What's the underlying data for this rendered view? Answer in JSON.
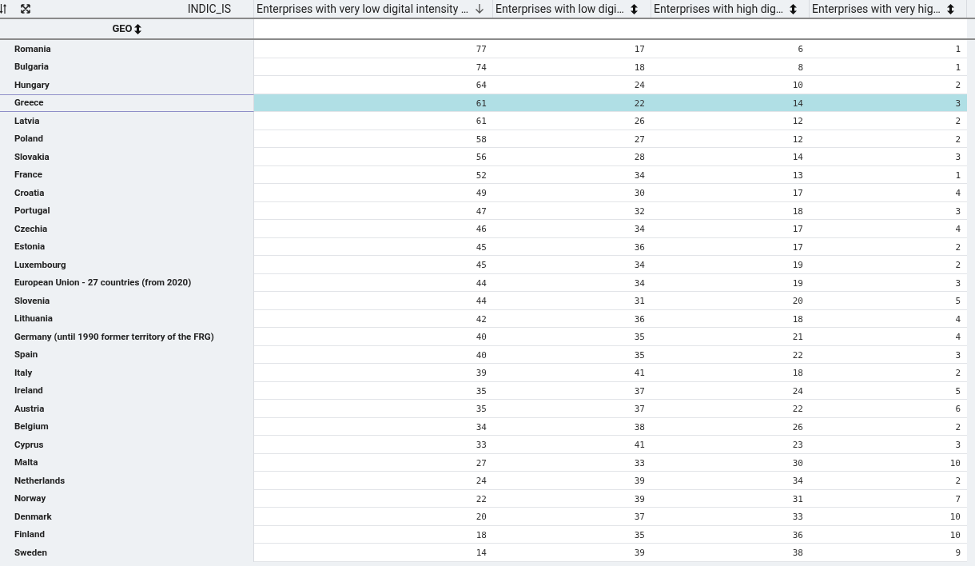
{
  "toolbar": {
    "pivot_label": "INDIC_IS",
    "row_header": "GEO"
  },
  "columns": [
    {
      "label": "Enterprises with very low digital intensity …",
      "sorted": true
    },
    {
      "label": "Enterprises with low digi…",
      "sorted": false
    },
    {
      "label": "Enterprises with high dig…",
      "sorted": false
    },
    {
      "label": "Enterprises with very hig…",
      "sorted": false
    }
  ],
  "rows": [
    {
      "geo": "Romania",
      "values": [
        "77",
        "17",
        "6",
        "1"
      ],
      "selected": false
    },
    {
      "geo": "Bulgaria",
      "values": [
        "74",
        "18",
        "8",
        "1"
      ],
      "selected": false
    },
    {
      "geo": "Hungary",
      "values": [
        "64",
        "24",
        "10",
        "2"
      ],
      "selected": false
    },
    {
      "geo": "Greece",
      "values": [
        "61",
        "22",
        "14",
        "3"
      ],
      "selected": true
    },
    {
      "geo": "Latvia",
      "values": [
        "61",
        "26",
        "12",
        "2"
      ],
      "selected": false
    },
    {
      "geo": "Poland",
      "values": [
        "58",
        "27",
        "12",
        "2"
      ],
      "selected": false
    },
    {
      "geo": "Slovakia",
      "values": [
        "56",
        "28",
        "14",
        "3"
      ],
      "selected": false
    },
    {
      "geo": "France",
      "values": [
        "52",
        "34",
        "13",
        "1"
      ],
      "selected": false
    },
    {
      "geo": "Croatia",
      "values": [
        "49",
        "30",
        "17",
        "4"
      ],
      "selected": false
    },
    {
      "geo": "Portugal",
      "values": [
        "47",
        "32",
        "18",
        "3"
      ],
      "selected": false
    },
    {
      "geo": "Czechia",
      "values": [
        "46",
        "34",
        "17",
        "4"
      ],
      "selected": false
    },
    {
      "geo": "Estonia",
      "values": [
        "45",
        "36",
        "17",
        "2"
      ],
      "selected": false
    },
    {
      "geo": "Luxembourg",
      "values": [
        "45",
        "34",
        "19",
        "2"
      ],
      "selected": false
    },
    {
      "geo": "European Union - 27 countries (from 2020)",
      "values": [
        "44",
        "34",
        "19",
        "3"
      ],
      "selected": false
    },
    {
      "geo": "Slovenia",
      "values": [
        "44",
        "31",
        "20",
        "5"
      ],
      "selected": false
    },
    {
      "geo": "Lithuania",
      "values": [
        "42",
        "36",
        "18",
        "4"
      ],
      "selected": false
    },
    {
      "geo": "Germany (until 1990 former territory of the FRG)",
      "values": [
        "40",
        "35",
        "21",
        "4"
      ],
      "selected": false
    },
    {
      "geo": "Spain",
      "values": [
        "40",
        "35",
        "22",
        "3"
      ],
      "selected": false
    },
    {
      "geo": "Italy",
      "values": [
        "39",
        "41",
        "18",
        "2"
      ],
      "selected": false
    },
    {
      "geo": "Ireland",
      "values": [
        "35",
        "37",
        "24",
        "5"
      ],
      "selected": false
    },
    {
      "geo": "Austria",
      "values": [
        "35",
        "37",
        "22",
        "6"
      ],
      "selected": false
    },
    {
      "geo": "Belgium",
      "values": [
        "34",
        "38",
        "26",
        "2"
      ],
      "selected": false
    },
    {
      "geo": "Cyprus",
      "values": [
        "33",
        "41",
        "23",
        "3"
      ],
      "selected": false
    },
    {
      "geo": "Malta",
      "values": [
        "27",
        "33",
        "30",
        "10"
      ],
      "selected": false
    },
    {
      "geo": "Netherlands",
      "values": [
        "24",
        "39",
        "34",
        "2"
      ],
      "selected": false
    },
    {
      "geo": "Norway",
      "values": [
        "22",
        "39",
        "31",
        "7"
      ],
      "selected": false
    },
    {
      "geo": "Denmark",
      "values": [
        "20",
        "37",
        "33",
        "10"
      ],
      "selected": false
    },
    {
      "geo": "Finland",
      "values": [
        "18",
        "35",
        "36",
        "10"
      ],
      "selected": false
    },
    {
      "geo": "Sweden",
      "values": [
        "14",
        "39",
        "38",
        "9"
      ],
      "selected": false
    }
  ]
}
